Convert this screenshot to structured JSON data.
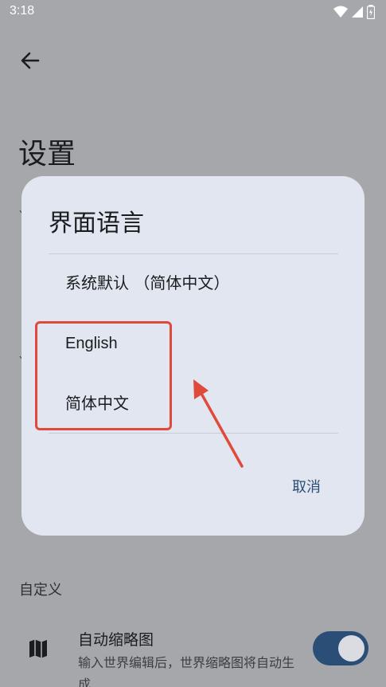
{
  "status_bar": {
    "time": "3:18"
  },
  "page": {
    "title": "设置"
  },
  "section": {
    "custom_label": "自定义"
  },
  "setting": {
    "title": "自动缩略图",
    "description": "输入世界编辑后，世界缩略图将自动生成",
    "enabled": true
  },
  "dialog": {
    "title": "界面语言",
    "options": [
      {
        "label": "系统默认 （简体中文）"
      },
      {
        "label": "English"
      },
      {
        "label": "简体中文"
      }
    ],
    "cancel_label": "取消"
  },
  "colors": {
    "scrim": "#A6A7AB",
    "dialog_bg": "#E2E6F0",
    "accent": "#2B4E77",
    "annotation": "#E04A3A"
  }
}
